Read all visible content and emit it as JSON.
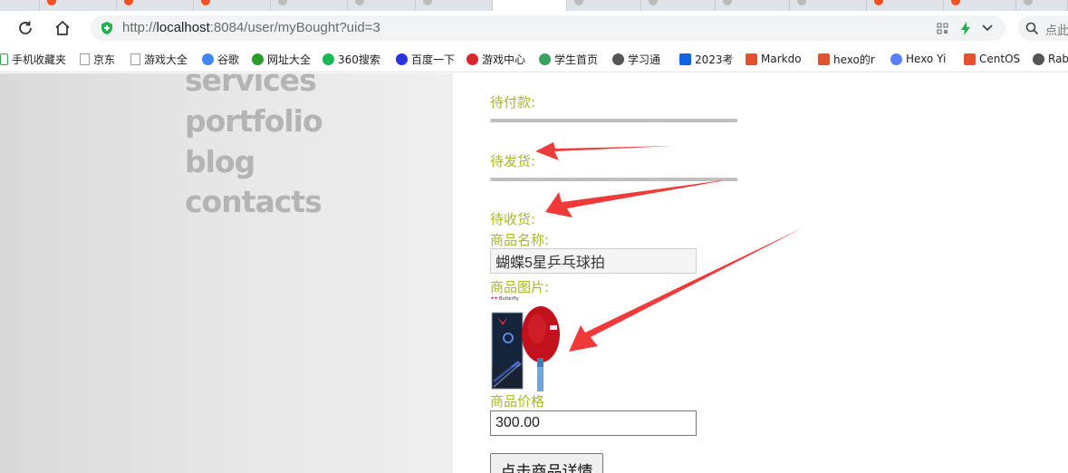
{
  "browser": {
    "url": {
      "prefix": "http://",
      "host": "localhost",
      "path": ":8084/user/myBought?uid=3"
    },
    "search_hint": "点此",
    "icons": [
      "reload-icon",
      "home-icon",
      "shield-icon",
      "qr-icon",
      "bolt-icon",
      "chevron-down-icon",
      "search-icon"
    ]
  },
  "bookmarks": [
    {
      "label": "手机收藏夹",
      "icon": "phone-icon",
      "color": "#2aa84a"
    },
    {
      "label": "京东",
      "icon": "page-icon",
      "color": "#9a9a9a"
    },
    {
      "label": "游戏大全",
      "icon": "page-icon",
      "color": "#9a9a9a"
    },
    {
      "label": "谷歌",
      "icon": "google-icon",
      "color": "#4285f4"
    },
    {
      "label": "网址大全",
      "icon": "nav-icon",
      "color": "#2c9c2c"
    },
    {
      "label": "360搜索",
      "icon": "so360-icon",
      "color": "#19b955"
    },
    {
      "label": "百度一下",
      "icon": "baidu-icon",
      "color": "#2932e1"
    },
    {
      "label": "游戏中心",
      "icon": "game-icon",
      "color": "#d9262c"
    },
    {
      "label": "学生首页",
      "icon": "student-icon",
      "color": "#38a35f"
    },
    {
      "label": "学习通",
      "icon": "globe-icon",
      "color": "#555555"
    },
    {
      "label": "2023考",
      "icon": "zhihu-icon",
      "color": "#0a66e1"
    },
    {
      "label": "Markdo",
      "icon": "csdn-icon",
      "color": "#e5512f"
    },
    {
      "label": "hexo的r",
      "icon": "csdn-icon",
      "color": "#e5512f"
    },
    {
      "label": "Hexo Yi",
      "icon": "hexo-icon",
      "color": "#5b7ff7"
    },
    {
      "label": "CentOS",
      "icon": "csdn-icon",
      "color": "#e5512f"
    },
    {
      "label": "Rab",
      "icon": "rab-icon",
      "color": "#555555"
    }
  ],
  "sidebar_nav": [
    "services",
    "portfolio",
    "blog",
    "contacts"
  ],
  "orders": {
    "pending_payment_label": "待付款:",
    "pending_shipment_label": "待发货:",
    "pending_receipt_label": "待收货:",
    "separator": "=============================================================================",
    "product_name_label": "商品名称:",
    "product_name": "蝴蝶5星乒乓球拍",
    "product_image_label": "商品图片:",
    "product_brand": "Butterfly",
    "product_price_label": "商品价格",
    "product_price": "300.00",
    "detail_button": "点击商品详情"
  },
  "colors": {
    "label_green": "#a9b927",
    "annotation_arrow": "#f03a3a",
    "sidebar_text": "#b4b4b4"
  }
}
